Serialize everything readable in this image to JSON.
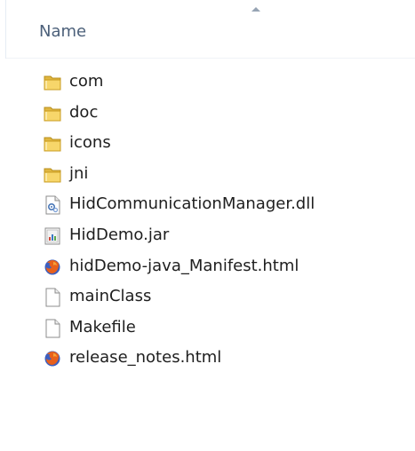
{
  "header": {
    "column_name": "Name",
    "sort_indicator_icon": "sort-ascending-icon"
  },
  "files": [
    {
      "label": "com",
      "icon": "folder-icon",
      "kind": "folder"
    },
    {
      "label": "doc",
      "icon": "folder-icon",
      "kind": "folder"
    },
    {
      "label": "icons",
      "icon": "folder-icon",
      "kind": "folder"
    },
    {
      "label": "jni",
      "icon": "folder-icon",
      "kind": "folder"
    },
    {
      "label": "HidCommunicationManager.dll",
      "icon": "dll-file-icon",
      "kind": "dll"
    },
    {
      "label": "HidDemo.jar",
      "icon": "jar-file-icon",
      "kind": "jar"
    },
    {
      "label": "hidDemo-java_Manifest.html",
      "icon": "firefox-html-icon",
      "kind": "html"
    },
    {
      "label": "mainClass",
      "icon": "blank-file-icon",
      "kind": "blank"
    },
    {
      "label": "Makefile",
      "icon": "blank-file-icon",
      "kind": "blank"
    },
    {
      "label": "release_notes.html",
      "icon": "firefox-html-icon",
      "kind": "html"
    }
  ],
  "colors": {
    "header_text": "#4c607a",
    "file_text": "#1e1e1e",
    "folder_yellow": "#f2c94c"
  }
}
